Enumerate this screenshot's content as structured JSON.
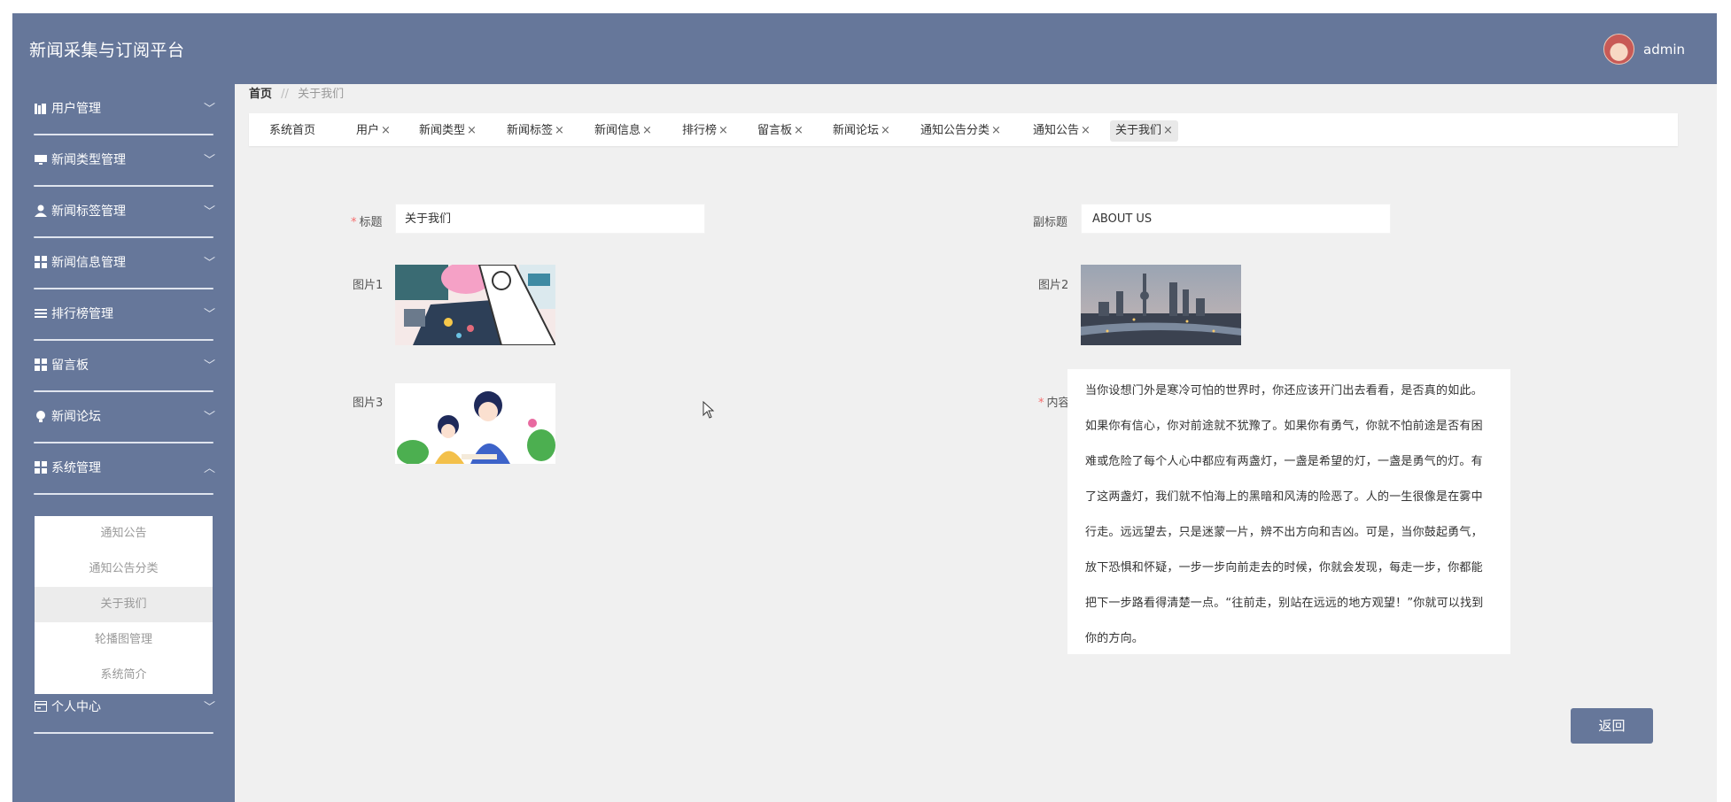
{
  "header": {
    "app_title": "新闻采集与订阅平台",
    "username": "admin"
  },
  "sidebar": {
    "items": [
      {
        "label": "用户管理",
        "icon": "bar-chart-icon",
        "expanded": false
      },
      {
        "label": "新闻类型管理",
        "icon": "monitor-icon",
        "expanded": false
      },
      {
        "label": "新闻标签管理",
        "icon": "user-icon",
        "expanded": false
      },
      {
        "label": "新闻信息管理",
        "icon": "grid-icon",
        "expanded": false
      },
      {
        "label": "排行榜管理",
        "icon": "list-icon",
        "expanded": false
      },
      {
        "label": "留言板",
        "icon": "grid-icon",
        "expanded": false
      },
      {
        "label": "新闻论坛",
        "icon": "bulb-icon",
        "expanded": false
      },
      {
        "label": "系统管理",
        "icon": "grid-icon",
        "expanded": true
      },
      {
        "label": "个人中心",
        "icon": "card-icon",
        "expanded": false
      }
    ],
    "submenu": [
      {
        "label": "通知公告",
        "active": false
      },
      {
        "label": "通知公告分类",
        "active": false
      },
      {
        "label": "关于我们",
        "active": true
      },
      {
        "label": "轮播图管理",
        "active": false
      },
      {
        "label": "系统简介",
        "active": false
      }
    ]
  },
  "breadcrumb": {
    "home": "首页",
    "separator": "//",
    "current": "关于我们"
  },
  "tabs": [
    {
      "label": "系统首页",
      "closable": false
    },
    {
      "label": "用户",
      "closable": true
    },
    {
      "label": "新闻类型",
      "closable": true
    },
    {
      "label": "新闻标签",
      "closable": true
    },
    {
      "label": "新闻信息",
      "closable": true
    },
    {
      "label": "排行榜",
      "closable": true
    },
    {
      "label": "留言板",
      "closable": true
    },
    {
      "label": "新闻论坛",
      "closable": true
    },
    {
      "label": "通知公告分类",
      "closable": true
    },
    {
      "label": "通知公告",
      "closable": true
    },
    {
      "label": "关于我们",
      "closable": true,
      "active": true
    }
  ],
  "tab_close_glyph": "×",
  "form": {
    "title": {
      "label": "标题",
      "required": true,
      "value": "关于我们"
    },
    "subtitle": {
      "label": "副标题",
      "required": false,
      "value": "ABOUT US"
    },
    "image1": {
      "label": "图片1"
    },
    "image2": {
      "label": "图片2"
    },
    "image3": {
      "label": "图片3"
    },
    "content": {
      "label": "内容",
      "required": true,
      "value": "当你设想门外是寒冷可怕的世界时，你还应该开门出去看看，是否真的如此。如果你有信心，你对前途就不犹豫了。如果你有勇气，你就不怕前途是否有困难或危险了每个人心中都应有两盏灯，一盏是希望的灯，一盏是勇气的灯。有了这两盏灯，我们就不怕海上的黑暗和风涛的险恶了。人的一生很像是在雾中行走。远远望去，只是迷蒙一片，辨不出方向和吉凶。可是，当你鼓起勇气，放下恐惧和怀疑，一步一步向前走去的时候，你就会发现，每走一步，你都能把下一步路看得清楚一点。“往前走，别站在远远的地方观望！”你就可以找到你的方向。"
    }
  },
  "buttons": {
    "back": "返回"
  },
  "colors": {
    "primary": "#66779a",
    "background": "#f0f0f0",
    "required": "#f56c6c"
  }
}
